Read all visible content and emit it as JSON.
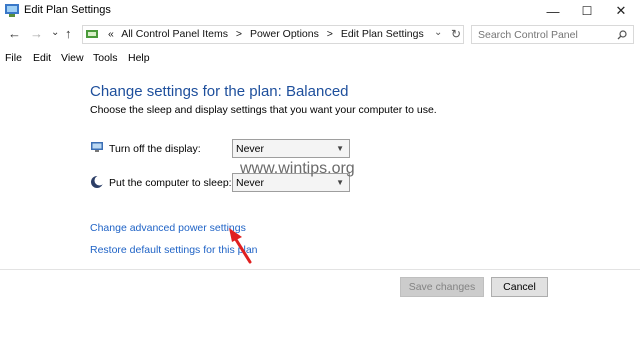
{
  "window": {
    "title": "Edit Plan Settings",
    "minimize": "—",
    "maximize": "☐",
    "close": "✕"
  },
  "nav": {
    "back": "←",
    "forward": "→",
    "recent": "⌄",
    "up": "↑",
    "breadcrumb_prefix": "«",
    "breadcrumbs": [
      "All Control Panel Items",
      "Power Options",
      "Edit Plan Settings"
    ],
    "separator": ">",
    "refresh": "↻"
  },
  "search": {
    "placeholder": "Search Control Panel"
  },
  "menu": [
    "File",
    "Edit",
    "View",
    "Tools",
    "Help"
  ],
  "main": {
    "heading": "Change settings for the plan: Balanced",
    "subheading": "Choose the sleep and display settings that you want your computer to use.",
    "settings": [
      {
        "label": "Turn off the display:",
        "value": "Never",
        "icon": "display-icon"
      },
      {
        "label": "Put the computer to sleep:",
        "value": "Never",
        "icon": "moon-icon"
      }
    ],
    "links": [
      "Change advanced power settings",
      "Restore default settings for this plan"
    ],
    "watermark": "www.wintips.org"
  },
  "buttons": {
    "save": "Save changes",
    "cancel": "Cancel"
  },
  "colors": {
    "heading": "#1e4f9c",
    "link": "#1f63c6",
    "arrow": "#e02020"
  }
}
